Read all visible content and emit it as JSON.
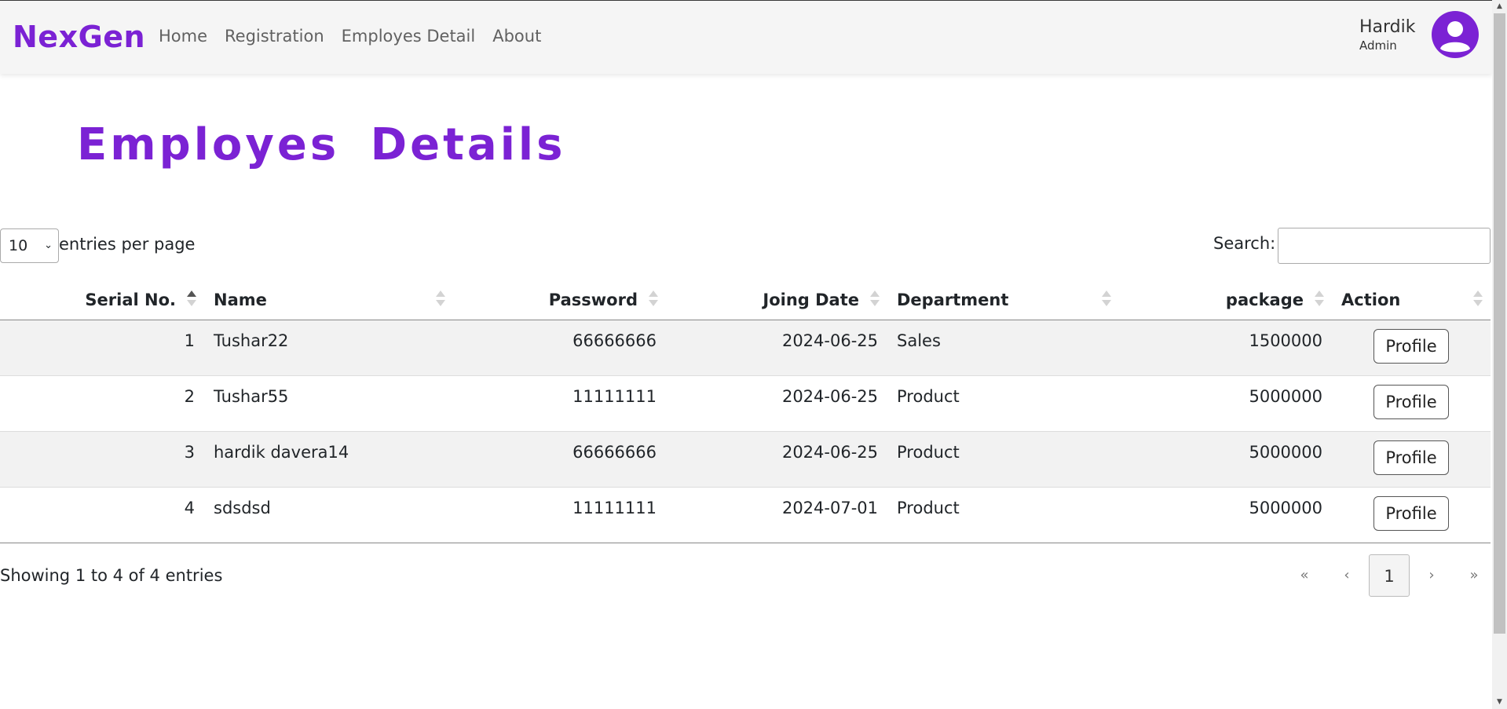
{
  "nav": {
    "brand": "NexGen",
    "links": [
      "Home",
      "Registration",
      "Employes Detail",
      "About"
    ],
    "user_name": "Hardik",
    "user_role": "Admin"
  },
  "page": {
    "title": "Employes Details"
  },
  "controls": {
    "page_length": "10",
    "page_length_label": "entries per page",
    "search_label": "Search:",
    "search_value": ""
  },
  "table": {
    "columns": [
      "Serial No.",
      "Name",
      "Password",
      "Joing Date",
      "Department",
      "package",
      "Action"
    ],
    "rows": [
      {
        "serial": "1",
        "name": "Tushar22",
        "password": "66666666",
        "date": "2024-06-25",
        "department": "Sales",
        "package": "1500000",
        "action": "Profile"
      },
      {
        "serial": "2",
        "name": "Tushar55",
        "password": "11111111",
        "date": "2024-06-25",
        "department": "Product",
        "package": "5000000",
        "action": "Profile"
      },
      {
        "serial": "3",
        "name": "hardik davera14",
        "password": "66666666",
        "date": "2024-06-25",
        "department": "Product",
        "package": "5000000",
        "action": "Profile"
      },
      {
        "serial": "4",
        "name": "sdsdsd",
        "password": "11111111",
        "date": "2024-07-01",
        "department": "Product",
        "package": "5000000",
        "action": "Profile"
      }
    ]
  },
  "footer": {
    "info": "Showing 1 to 4 of 4 entries",
    "pagination": {
      "first": "«",
      "prev": "‹",
      "current": "1",
      "next": "›",
      "last": "»"
    }
  },
  "colors": {
    "accent": "#7b22d4",
    "stripe": "#f2f2f2",
    "navbar_bg": "#f5f5f5"
  },
  "icons": {
    "avatar": "user-avatar-icon",
    "sort": "sort-arrows-icon"
  }
}
